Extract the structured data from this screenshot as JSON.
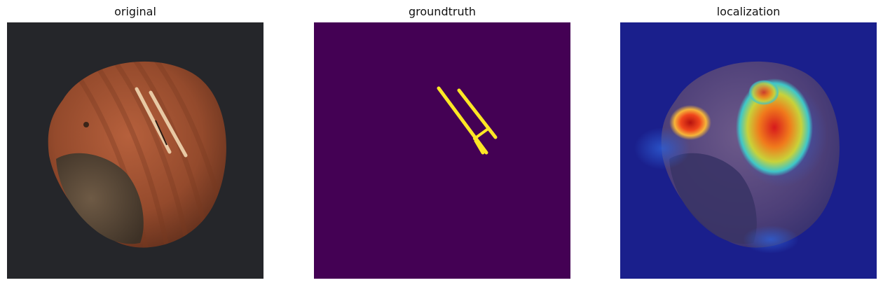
{
  "panels": [
    {
      "title": "original"
    },
    {
      "title": "groundtruth"
    },
    {
      "title": "localization"
    }
  ],
  "colors": {
    "background_dark": "#25262a",
    "mask_background": "#440154",
    "mask_foreground": "#fde725",
    "heatmap_cold": "#1a1f8c",
    "heatmap_hot": "#d7191c"
  }
}
